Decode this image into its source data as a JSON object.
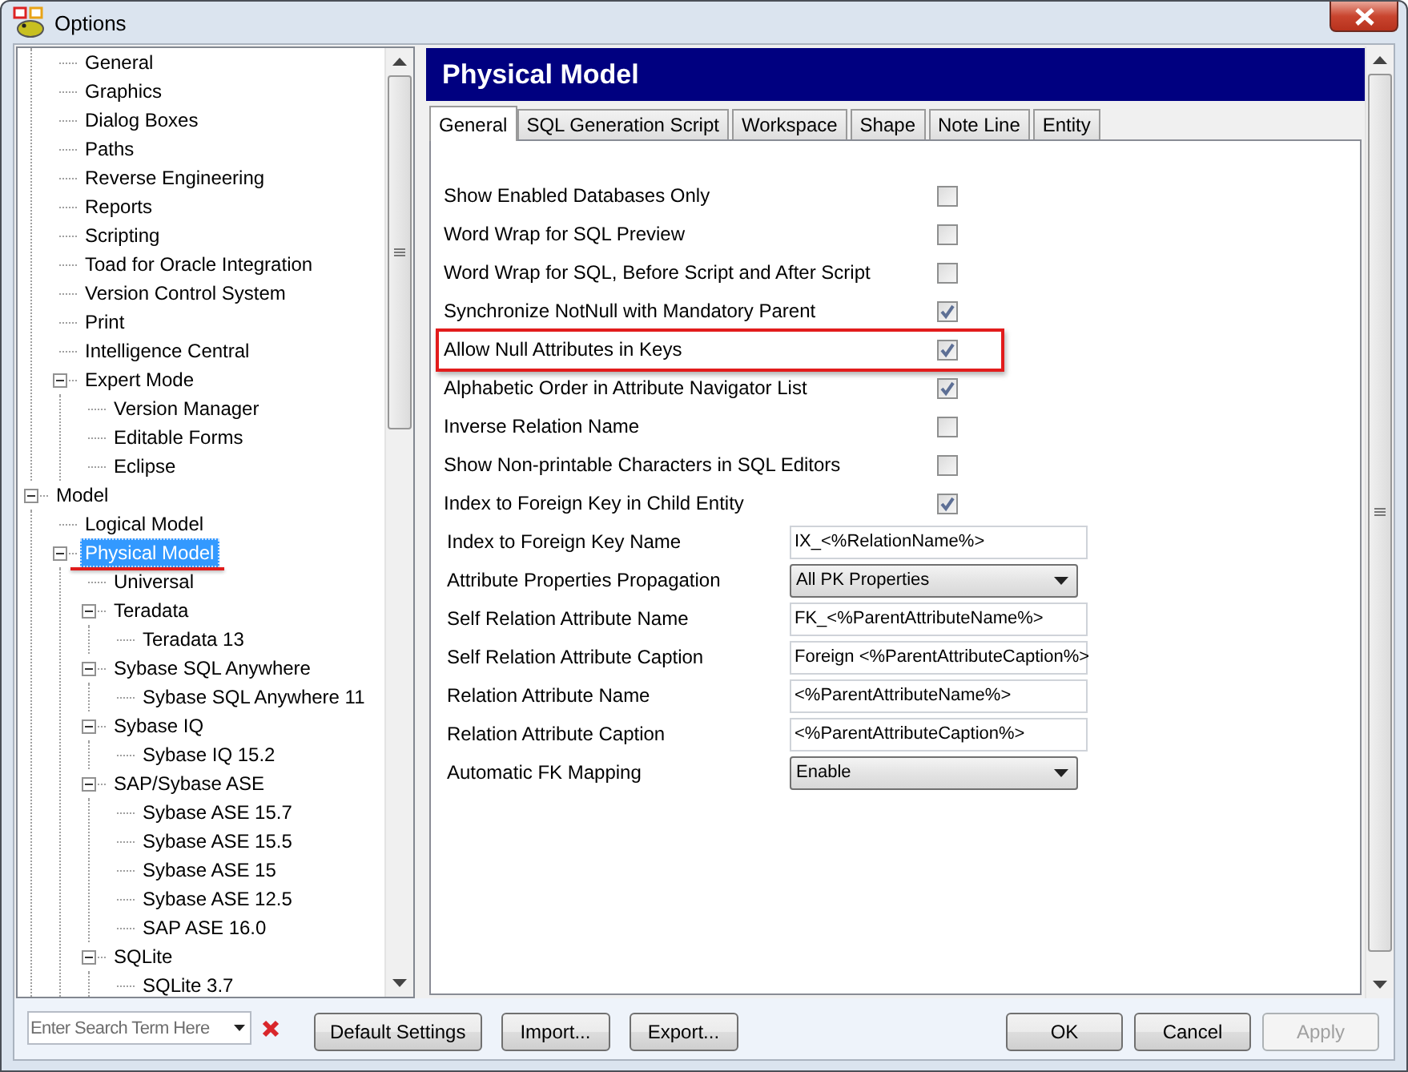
{
  "window": {
    "title": "Options"
  },
  "tree": [
    {
      "children": [
        {
          "label": "General",
          "selected": false,
          "annotated": false
        },
        {
          "label": "Graphics",
          "selected": false,
          "annotated": false
        },
        {
          "label": "Dialog Boxes",
          "selected": false,
          "annotated": false
        },
        {
          "label": "Paths",
          "selected": false,
          "annotated": false
        },
        {
          "label": "Reverse Engineering",
          "selected": false,
          "annotated": false
        },
        {
          "label": "Reports",
          "selected": false,
          "annotated": false
        },
        {
          "label": "Scripting",
          "selected": false,
          "annotated": false
        },
        {
          "label": "Toad for Oracle Integration",
          "selected": false,
          "annotated": false
        },
        {
          "label": "Version Control System",
          "selected": false,
          "annotated": false
        },
        {
          "label": "Print",
          "selected": false,
          "annotated": false
        },
        {
          "label": "Intelligence Central",
          "selected": false,
          "annotated": false
        },
        {
          "label": "Expert Mode",
          "selected": false,
          "annotated": false,
          "expanded": true,
          "children": [
            {
              "label": "Version Manager",
              "selected": false,
              "annotated": false
            },
            {
              "label": "Editable Forms",
              "selected": false,
              "annotated": false
            },
            {
              "label": "Eclipse",
              "selected": false,
              "annotated": false
            }
          ]
        }
      ]
    },
    {
      "label": "Model",
      "selected": false,
      "annotated": false,
      "expanded": true,
      "children": [
        {
          "label": "Logical Model",
          "selected": false,
          "annotated": false
        },
        {
          "label": "Physical Model",
          "selected": true,
          "annotated": true,
          "expanded": true,
          "children": [
            {
              "label": "Universal",
              "selected": false,
              "annotated": false
            },
            {
              "label": "Teradata",
              "selected": false,
              "annotated": false,
              "expanded": true,
              "children": [
                {
                  "label": "Teradata 13",
                  "selected": false,
                  "annotated": false
                }
              ]
            },
            {
              "label": "Sybase SQL Anywhere",
              "selected": false,
              "annotated": false,
              "expanded": true,
              "children": [
                {
                  "label": "Sybase SQL Anywhere 11",
                  "selected": false,
                  "annotated": false
                }
              ]
            },
            {
              "label": "Sybase IQ",
              "selected": false,
              "annotated": false,
              "expanded": true,
              "children": [
                {
                  "label": "Sybase IQ 15.2",
                  "selected": false,
                  "annotated": false
                }
              ]
            },
            {
              "label": "SAP/Sybase ASE",
              "selected": false,
              "annotated": false,
              "expanded": true,
              "children": [
                {
                  "label": "Sybase ASE 15.7",
                  "selected": false,
                  "annotated": false
                },
                {
                  "label": "Sybase ASE 15.5",
                  "selected": false,
                  "annotated": false
                },
                {
                  "label": "Sybase ASE 15",
                  "selected": false,
                  "annotated": false
                },
                {
                  "label": "Sybase ASE 12.5",
                  "selected": false,
                  "annotated": false
                },
                {
                  "label": "SAP ASE 16.0",
                  "selected": false,
                  "annotated": false
                }
              ]
            },
            {
              "label": "SQLite",
              "selected": false,
              "annotated": false,
              "expanded": true,
              "children": [
                {
                  "label": "SQLite 3.7",
                  "selected": false,
                  "annotated": false
                }
              ]
            }
          ]
        }
      ]
    }
  ],
  "panel": {
    "title": "Physical Model"
  },
  "tabs": [
    {
      "label": "General",
      "selected": true
    },
    {
      "label": "SQL Generation Script",
      "selected": false
    },
    {
      "label": "Workspace",
      "selected": false
    },
    {
      "label": "Shape",
      "selected": false
    },
    {
      "label": "Note Line",
      "selected": false
    },
    {
      "label": "Entity",
      "selected": false
    }
  ],
  "options": [
    {
      "label": "Show Enabled Databases Only",
      "checked": false,
      "highlighted": false
    },
    {
      "label": "Word Wrap for SQL Preview",
      "checked": false,
      "highlighted": false
    },
    {
      "label": "Word Wrap for SQL, Before Script and After Script",
      "checked": false,
      "highlighted": false
    },
    {
      "label": "Synchronize NotNull with Mandatory Parent",
      "checked": true,
      "highlighted": false
    },
    {
      "label": "Allow Null Attributes in Keys",
      "checked": true,
      "highlighted": true
    },
    {
      "label": "Alphabetic Order in Attribute Navigator List",
      "checked": true,
      "highlighted": false
    },
    {
      "label": "Inverse Relation Name",
      "checked": false,
      "highlighted": false
    },
    {
      "label": "Show Non-printable Characters in SQL Editors",
      "checked": false,
      "highlighted": false
    },
    {
      "label": "Index to Foreign Key in Child Entity",
      "checked": true,
      "highlighted": false
    }
  ],
  "fields": [
    {
      "label": "Index to Foreign Key Name",
      "kind": "text",
      "value": "IX_<%RelationName%>"
    },
    {
      "label": "Attribute Properties Propagation",
      "kind": "dropdown",
      "value": "All PK Properties"
    },
    {
      "label": "Self Relation Attribute Name",
      "kind": "text",
      "value": "FK_<%ParentAttributeName%>"
    },
    {
      "label": "Self Relation Attribute Caption",
      "kind": "text",
      "value": "Foreign <%ParentAttributeCaption%>"
    },
    {
      "label": "Relation Attribute Name",
      "kind": "text",
      "value": "<%ParentAttributeName%>"
    },
    {
      "label": "Relation Attribute Caption",
      "kind": "text",
      "value": "<%ParentAttributeCaption%>"
    },
    {
      "label": "Automatic FK Mapping",
      "kind": "dropdown",
      "value": "Enable"
    }
  ],
  "search": {
    "placeholder": "Enter Search Term Here"
  },
  "buttons_left": [
    {
      "label": "Default Settings",
      "disabled": false
    },
    {
      "label": "Import...",
      "disabled": false
    },
    {
      "label": "Export...",
      "disabled": false
    }
  ],
  "buttons_right": [
    {
      "label": "OK",
      "disabled": false
    },
    {
      "label": "Cancel",
      "disabled": false
    },
    {
      "label": "Apply",
      "disabled": true
    }
  ]
}
